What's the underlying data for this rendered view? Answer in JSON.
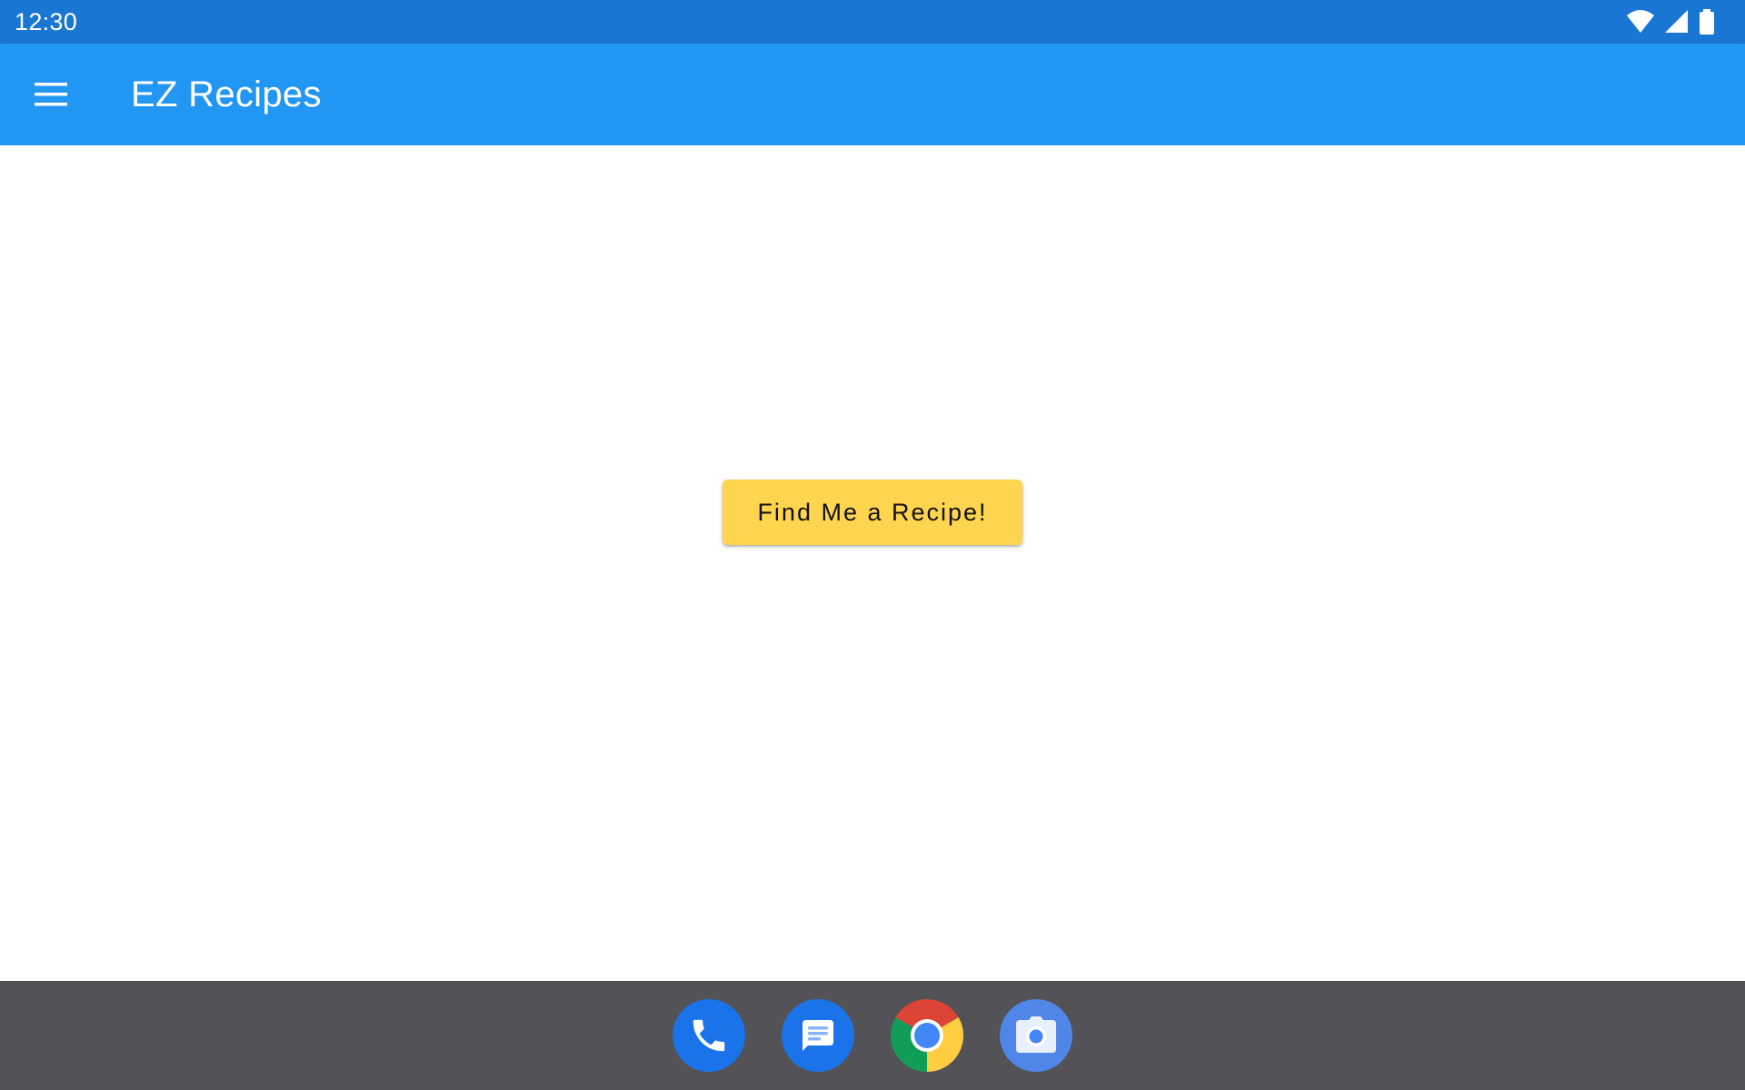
{
  "status_bar": {
    "time": "12:30",
    "icons": [
      "wifi-icon",
      "cell-signal-icon",
      "battery-icon"
    ]
  },
  "app_bar": {
    "menu_icon": "hamburger-menu-icon",
    "title": "EZ Recipes"
  },
  "main": {
    "find_button_label": "Find Me a Recipe!"
  },
  "dock": {
    "apps": [
      {
        "name": "Phone",
        "icon": "phone-icon"
      },
      {
        "name": "Messages",
        "icon": "messages-icon"
      },
      {
        "name": "Chrome",
        "icon": "chrome-icon"
      },
      {
        "name": "Camera",
        "icon": "camera-icon"
      }
    ]
  },
  "colors": {
    "status_bar": "#1976d2",
    "app_bar": "#2196f3",
    "button": "#ffd54f",
    "dock": "#535257",
    "background": "#ffffff"
  }
}
